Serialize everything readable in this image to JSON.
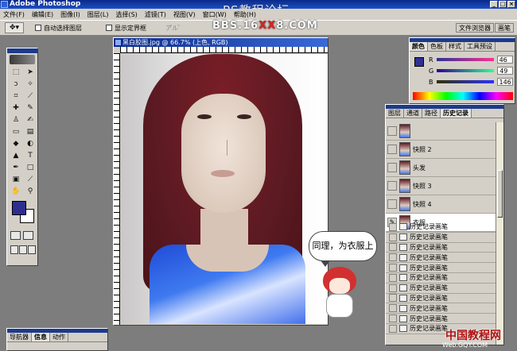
{
  "app": {
    "title": "Adobe Photoshop",
    "watermark": "PS教程论坛",
    "bbs": "BBS.16",
    "bbs_xx": "XX",
    "bbs_end": "8.COM"
  },
  "menu": [
    "文件(F)",
    "编辑(E)",
    "图像(I)",
    "图层(L)",
    "选择(S)",
    "滤镜(T)",
    "视图(V)",
    "窗口(W)",
    "帮助(H)"
  ],
  "options": {
    "auto_select": "自动选择图层",
    "show_bounds": "显示定界框",
    "align_label": "ア゙ル ゙゙"
  },
  "palette_well": [
    "文件浏览器",
    "画笔"
  ],
  "document": {
    "title": "黑白胶图.jpg @ 66.7% (上色, RGB)"
  },
  "annotation": {
    "bubble": "同理，为衣服上色"
  },
  "color_panel": {
    "tabs": [
      "颜色",
      "色板",
      "样式",
      "工具预设"
    ],
    "channels": [
      {
        "label": "R",
        "value": "46",
        "color": "#c02040"
      },
      {
        "label": "G",
        "value": "49",
        "color": "#20a040"
      },
      {
        "label": "B",
        "value": "146",
        "color": "#2030c0"
      }
    ],
    "swatch": "#2e3192"
  },
  "history_panel": {
    "tabs": [
      "图层",
      "通道",
      "路径",
      "历史记录"
    ],
    "snapshots": [
      {
        "label": ""
      },
      {
        "label": "快照 2"
      },
      {
        "label": "头发"
      },
      {
        "label": "快照 3"
      },
      {
        "label": "快照 4"
      },
      {
        "label": "衣服"
      }
    ],
    "steps": [
      "历史记录画笔",
      "历史记录画笔",
      "历史记录画笔",
      "历史记录画笔",
      "历史记录画笔",
      "历史记录画笔",
      "历史记录画笔",
      "历史记录画笔",
      "历史记录画笔",
      "历史记录画笔",
      "历史记录画笔"
    ]
  },
  "nav_panel": {
    "tabs": [
      "导航器",
      "信息",
      "动作"
    ]
  },
  "footer_logo": {
    "cn": "中国教程网",
    "url": "Web.GQY.COM"
  },
  "foreground_color": "#2e2e8e"
}
